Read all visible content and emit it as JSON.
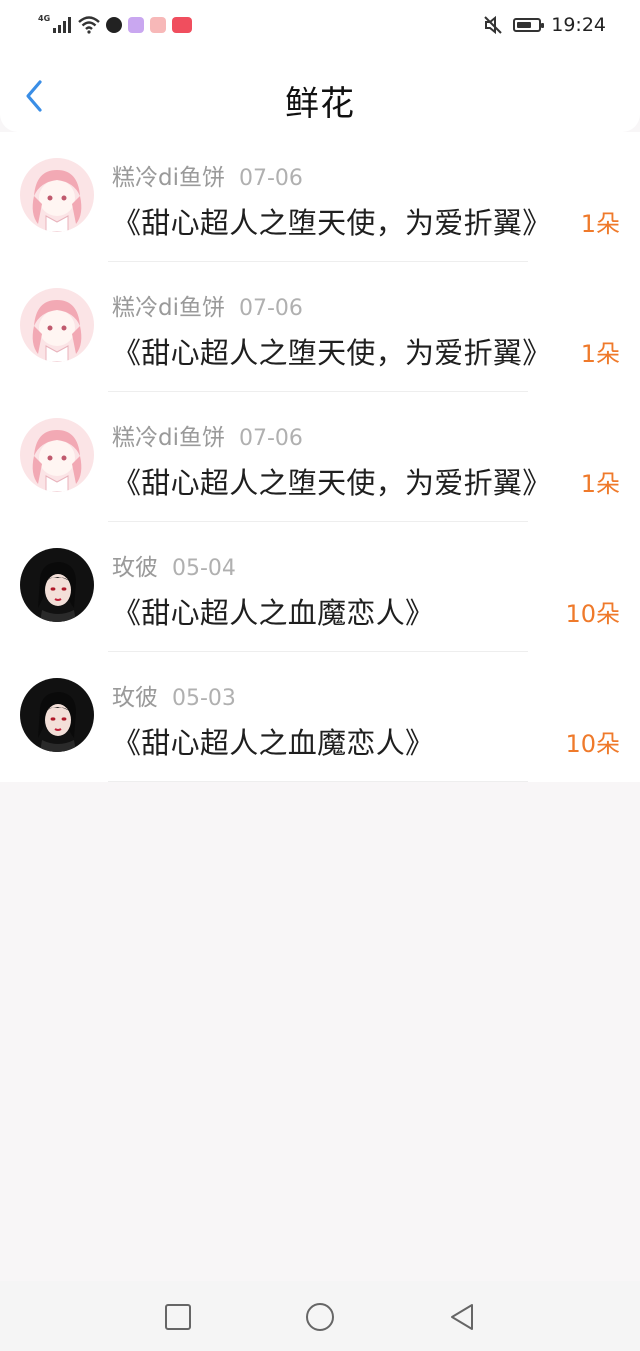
{
  "status": {
    "network": "4G",
    "time": "19:24",
    "battery_level": 0.7,
    "app_icons": [
      "tiktok-icon",
      "video-app-icon",
      "manga-app-icon",
      "xiaohongshu-icon"
    ]
  },
  "header": {
    "title": "鲜花",
    "back_icon": "chevron-left-icon",
    "accent": "#3a8ee6"
  },
  "flowers": [
    {
      "user": "糕冷di鱼饼",
      "date": "07-06",
      "book": "《甜心超人之堕天使，为爱折翼》",
      "count": "1朵",
      "avatar": "pink-hair-girl"
    },
    {
      "user": "糕冷di鱼饼",
      "date": "07-06",
      "book": "《甜心超人之堕天使，为爱折翼》",
      "count": "1朵",
      "avatar": "pink-hair-girl"
    },
    {
      "user": "糕冷di鱼饼",
      "date": "07-06",
      "book": "《甜心超人之堕天使，为爱折翼》",
      "count": "1朵",
      "avatar": "pink-hair-girl"
    },
    {
      "user": "玫彼",
      "date": "05-04",
      "book": "《甜心超人之血魔恋人》",
      "count": "10朵",
      "avatar": "dark-hair-girl"
    },
    {
      "user": "玫彼",
      "date": "05-03",
      "book": "《甜心超人之血魔恋人》",
      "count": "10朵",
      "avatar": "dark-hair-girl"
    }
  ],
  "colors": {
    "count": "#ef7a2b",
    "username": "#9a9a9a",
    "background": "#f8f6f7"
  },
  "navbar": [
    "recents-square-icon",
    "home-circle-icon",
    "back-triangle-icon"
  ]
}
